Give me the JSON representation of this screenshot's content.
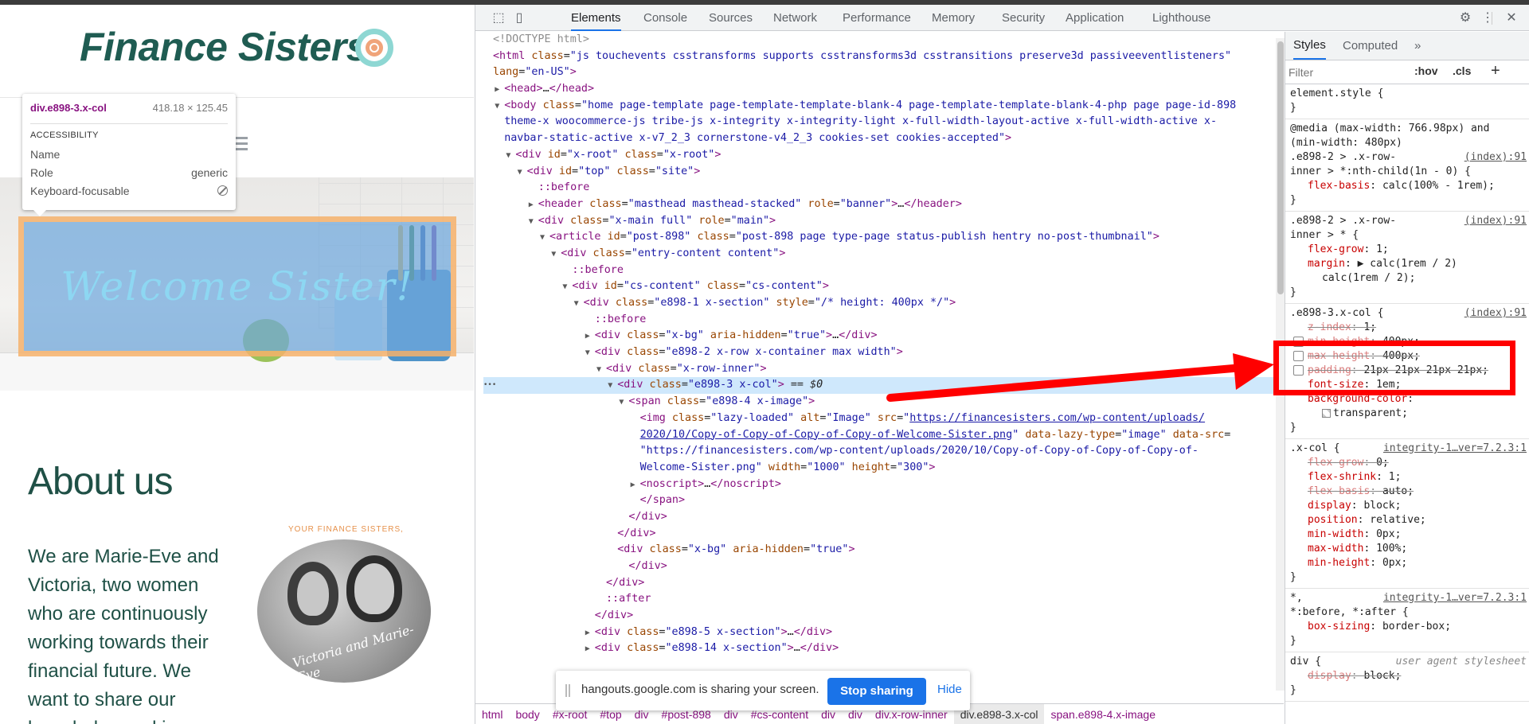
{
  "site": {
    "logo_text": "Finance Sisters",
    "hero_text": "Welcome Sister!",
    "about_title": "About us",
    "about_lines": [
      "We are Marie-Eve and",
      "Victoria, two women",
      "who are continuously",
      "working towards their",
      "financial future. We",
      "want to share our",
      "knowledge and journey"
    ],
    "portrait_caption": "YOUR FINANCE SISTERS,",
    "portrait_signature": "Victoria and Marie-Eve"
  },
  "tooltip": {
    "selector": "div.e898-3.x-col",
    "dimensions": "418.18 × 125.45",
    "section": "ACCESSIBILITY",
    "rows": [
      {
        "label": "Name",
        "value": ""
      },
      {
        "label": "Role",
        "value": "generic"
      },
      {
        "label": "Keyboard-focusable",
        "value": ""
      }
    ]
  },
  "devtools": {
    "tabs": [
      "Elements",
      "Console",
      "Sources",
      "Network",
      "Performance",
      "Memory",
      "Security",
      "Application",
      "Lighthouse"
    ],
    "active_tab": "Elements",
    "lines": [
      {
        "d": 0,
        "html": "<span class='cm'>&lt;!DOCTYPE html&gt;</span>"
      },
      {
        "d": 0,
        "html": "<span class='tg'>&lt;html</span> <span class='an'>class</span>=<span class='av'>\"js touchevents csstransforms supports csstransforms3d csstransitions preserve3d passiveeventlisteners\"</span>"
      },
      {
        "d": 0,
        "html": "<span class='an'>lang</span>=<span class='av'>\"en-US\"</span><span class='tg'>&gt;</span>"
      },
      {
        "d": 1,
        "t": "▶",
        "html": "<span class='tg'>&lt;head&gt;</span>…<span class='tg'>&lt;/head&gt;</span>"
      },
      {
        "d": 1,
        "t": "▼",
        "html": "<span class='tg'>&lt;body</span> <span class='an'>class</span>=<span class='av'>\"home page-template page-template-template-blank-4 page-template-template-blank-4-php page page-id-898</span>"
      },
      {
        "d": 1,
        "html": "<span class='av'>theme-x woocommerce-js tribe-js x-integrity x-integrity-light x-full-width-layout-active x-full-width-active x-</span>"
      },
      {
        "d": 1,
        "html": "<span class='av'>navbar-static-active x-v7_2_3 cornerstone-v4_2_3 cookies-set cookies-accepted\"</span><span class='tg'>&gt;</span>"
      },
      {
        "d": 2,
        "t": "▼",
        "html": "<span class='tg'>&lt;div</span> <span class='an'>id</span>=<span class='av'>\"x-root\"</span> <span class='an'>class</span>=<span class='av'>\"x-root\"</span><span class='tg'>&gt;</span>"
      },
      {
        "d": 3,
        "t": "▼",
        "html": "<span class='tg'>&lt;div</span> <span class='an'>id</span>=<span class='av'>\"top\"</span> <span class='an'>class</span>=<span class='av'>\"site\"</span><span class='tg'>&gt;</span>"
      },
      {
        "d": 4,
        "html": "<span class='ps'>::before</span>"
      },
      {
        "d": 4,
        "t": "▶",
        "html": "<span class='tg'>&lt;header</span> <span class='an'>class</span>=<span class='av'>\"masthead masthead-stacked\"</span> <span class='an'>role</span>=<span class='av'>\"banner\"</span><span class='tg'>&gt;</span>…<span class='tg'>&lt;/header&gt;</span>"
      },
      {
        "d": 4,
        "t": "▼",
        "html": "<span class='tg'>&lt;div</span> <span class='an'>class</span>=<span class='av'>\"x-main full\"</span> <span class='an'>role</span>=<span class='av'>\"main\"</span><span class='tg'>&gt;</span>"
      },
      {
        "d": 5,
        "t": "▼",
        "html": "<span class='tg'>&lt;article</span> <span class='an'>id</span>=<span class='av'>\"post-898\"</span> <span class='an'>class</span>=<span class='av'>\"post-898 page type-page status-publish hentry no-post-thumbnail\"</span><span class='tg'>&gt;</span>"
      },
      {
        "d": 6,
        "t": "▼",
        "html": "<span class='tg'>&lt;div</span> <span class='an'>class</span>=<span class='av'>\"entry-content content\"</span><span class='tg'>&gt;</span>"
      },
      {
        "d": 7,
        "html": "<span class='ps'>::before</span>"
      },
      {
        "d": 7,
        "t": "▼",
        "html": "<span class='tg'>&lt;div</span> <span class='an'>id</span>=<span class='av'>\"cs-content\"</span> <span class='an'>class</span>=<span class='av'>\"cs-content\"</span><span class='tg'>&gt;</span>"
      },
      {
        "d": 8,
        "t": "▼",
        "html": "<span class='tg'>&lt;div</span> <span class='an'>class</span>=<span class='av'>\"e898-1 x-section\"</span> <span class='an'>style</span>=<span class='av'>\"/* height: 400px */\"</span><span class='tg'>&gt;</span>"
      },
      {
        "d": 9,
        "html": "<span class='ps'>::before</span>"
      },
      {
        "d": 9,
        "t": "▶",
        "html": "<span class='tg'>&lt;div</span> <span class='an'>class</span>=<span class='av'>\"x-bg\"</span> <span class='an'>aria-hidden</span>=<span class='av'>\"true\"</span><span class='tg'>&gt;</span>…<span class='tg'>&lt;/div&gt;</span>"
      },
      {
        "d": 9,
        "t": "▼",
        "html": "<span class='tg'>&lt;div</span> <span class='an'>class</span>=<span class='av'>\"e898-2 x-row x-container max width\"</span><span class='tg'>&gt;</span>"
      },
      {
        "d": 10,
        "t": "▼",
        "html": "<span class='tg'>&lt;div</span> <span class='an'>class</span>=<span class='av'>\"x-row-inner\"</span><span class='tg'>&gt;</span>"
      },
      {
        "d": 11,
        "t": "▼",
        "sel": true,
        "html": "<span class='tg'>&lt;div</span> <span class='an'>class</span>=<span class='av'>\"e898-3 x-col\"</span><span class='tg'>&gt;</span> == <i>$0</i>"
      },
      {
        "d": 12,
        "t": "▼",
        "html": "<span class='tg'>&lt;span</span> <span class='an'>class</span>=<span class='av'>\"e898-4 x-image\"</span><span class='tg'>&gt;</span>"
      },
      {
        "d": 13,
        "html": "<span class='tg'>&lt;img</span> <span class='an'>class</span>=<span class='av'>\"lazy-loaded\"</span> <span class='an'>alt</span>=<span class='av'>\"Image\"</span> <span class='an'>src</span>=<span class='av'>\"</span><span class='lk'>https://financesisters.com/wp-content/uploads/</span>"
      },
      {
        "d": 13,
        "html": "<span class='lk'>2020/10/Copy-of-Copy-of-Copy-of-Copy-of-Welcome-Sister.png</span><span class='av'>\"</span> <span class='an'>data-lazy-type</span>=<span class='av'>\"image\"</span> <span class='an'>data-src</span>="
      },
      {
        "d": 13,
        "html": "<span class='av'>\"https://financesisters.com/wp-content/uploads/2020/10/Copy-of-Copy-of-Copy-of-Copy-of-</span>"
      },
      {
        "d": 13,
        "html": "<span class='av'>Welcome-Sister.png\"</span> <span class='an'>width</span>=<span class='av'>\"1000\"</span> <span class='an'>height</span>=<span class='av'>\"300\"</span><span class='tg'>&gt;</span>"
      },
      {
        "d": 13,
        "t": "▶",
        "html": "<span class='tg'>&lt;noscript&gt;</span>…<span class='tg'>&lt;/noscript&gt;</span>"
      },
      {
        "d": 13,
        "html": "<span class='tg'>&lt;/span&gt;</span>"
      },
      {
        "d": 12,
        "html": "<span class='tg'>&lt;/div&gt;</span>"
      },
      {
        "d": 11,
        "html": "<span class='tg'>&lt;/div&gt;</span>"
      },
      {
        "d": 11,
        "html": "<span class='tg'>&lt;div</span> <span class='an'>class</span>=<span class='av'>\"x-bg\"</span> <span class='an'>aria-hidden</span>=<span class='av'>\"true\"</span><span class='tg'>&gt;</span>"
      },
      {
        "d": 12,
        "html": "<span class='tg'>&lt;/div&gt;</span>"
      },
      {
        "d": 10,
        "html": "<span class='tg'>&lt;/div&gt;</span>"
      },
      {
        "d": 10,
        "html": "<span class='ps'>::after</span>"
      },
      {
        "d": 9,
        "html": "<span class='tg'>&lt;/div&gt;</span>"
      },
      {
        "d": 9,
        "t": "▶",
        "html": "<span class='tg'>&lt;div</span> <span class='an'>class</span>=<span class='av'>\"e898-5 x-section\"</span><span class='tg'>&gt;</span>…<span class='tg'>&lt;/div&gt;</span>"
      },
      {
        "d": 9,
        "t": "▶",
        "html": "<span class='tg'>&lt;div</span> <span class='an'>class</span>=<span class='av'>\"e898-14 x-section\"</span><span class='tg'>&gt;</span>…<span class='tg'>&lt;/div&gt;</span>"
      }
    ],
    "breadcrumbs": [
      "html",
      "body",
      "#x-root",
      "#top",
      "div",
      "#post-898",
      "div",
      "#cs-content",
      "div",
      "div",
      "div.x-row-inner",
      "div.e898-3.x-col",
      "span.e898-4.x-image"
    ],
    "active_crumb": "div.e898-3.x-col",
    "styles_tabs": [
      "Styles",
      "Computed",
      "»"
    ],
    "filter_placeholder": "Filter",
    "filter_hov": ":hov",
    "filter_cls": ".cls",
    "rules": [
      {
        "sel": [
          "element.style {"
        ],
        "src": "",
        "props": [],
        "close": "}"
      },
      {
        "sel": [
          "@media (max-width: 766.98px) and",
          "(min-width: 480px)",
          ".e898-2 > .x-row-",
          "inner > *:nth-child(1n - 0) {"
        ],
        "src": "(index):91",
        "src_line": 2,
        "props": [
          {
            "n": "flex-basis",
            "v": "calc(100% - 1rem);"
          }
        ],
        "close": "}"
      },
      {
        "sel": [
          ".e898-2 > .x-row-",
          "inner > * {"
        ],
        "src": "(index):91",
        "src_line": 0,
        "props": [
          {
            "n": "flex-grow",
            "v": "1;"
          },
          {
            "n": "margin",
            "v": "▶ calc(1rem / 2)"
          },
          {
            "n": "",
            "v": "  calc(1rem / 2);"
          }
        ],
        "close": "}"
      },
      {
        "sel": [
          ".e898-3.x-col {"
        ],
        "src": "(index):91",
        "src_line": 0,
        "props": [
          {
            "n": "z-index",
            "v": "1;",
            "s": true
          },
          {
            "n": "min-height",
            "v": "400px;",
            "s": true,
            "cb": true
          },
          {
            "n": "max-height",
            "v": "400px;",
            "s": true,
            "cb": true
          },
          {
            "n": "padding",
            "v": "21px 21px 21px 21px;",
            "s": true,
            "cb": true
          },
          {
            "n": "font-size",
            "v": "1em;"
          },
          {
            "n": "background-color",
            "v": ""
          },
          {
            "n": "",
            "v": "transparent;",
            "sw": true
          }
        ],
        "close": "}"
      },
      {
        "sel": [
          ".x-col {"
        ],
        "src": "integrity-1…ver=7.2.3:1",
        "src_line": 0,
        "props": [
          {
            "n": "flex-grow",
            "v": "0;",
            "s": true
          },
          {
            "n": "flex-shrink",
            "v": "1;"
          },
          {
            "n": "flex-basis",
            "v": "auto;",
            "s": true
          },
          {
            "n": "display",
            "v": "block;"
          },
          {
            "n": "position",
            "v": "relative;"
          },
          {
            "n": "min-width",
            "v": "0px;"
          },
          {
            "n": "max-width",
            "v": "100%;"
          },
          {
            "n": "min-height",
            "v": "0px;"
          }
        ],
        "close": "}"
      },
      {
        "sel": [
          "*,",
          "*:before, *:after {"
        ],
        "src": "integrity-1…ver=7.2.3:1",
        "src_line": 0,
        "props": [
          {
            "n": "box-sizing",
            "v": "border-box;"
          }
        ],
        "close": "}"
      },
      {
        "sel": [
          "div {"
        ],
        "src": "user agent stylesheet",
        "ua": true,
        "src_line": 0,
        "props": [
          {
            "n": "display",
            "v": "block;",
            "s": true
          }
        ],
        "close": "}"
      }
    ]
  },
  "sharebar": {
    "message": "hangouts.google.com is sharing your screen.",
    "stop_label": "Stop sharing",
    "hide_label": "Hide"
  },
  "colors": {
    "annotation": "#ff0000",
    "brand_green": "#1f5c52",
    "accent_blue": "#1a73e8"
  }
}
